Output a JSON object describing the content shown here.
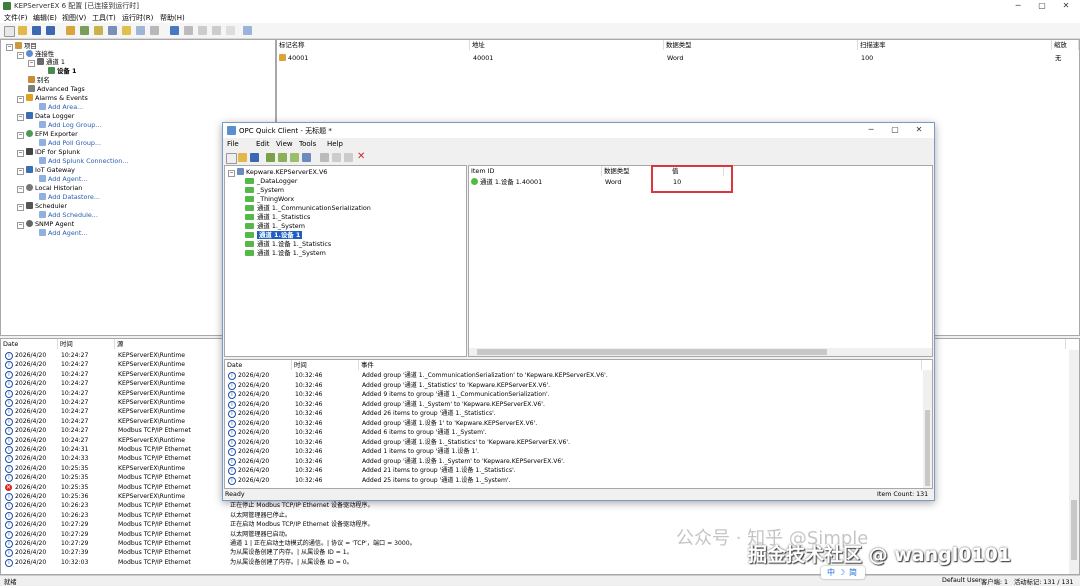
{
  "window": {
    "title": "KEPServerEX 6 配置 [已连接到运行时]",
    "min": "─",
    "max": "▢",
    "close": "✕"
  },
  "menu": [
    "文件(F)",
    "编辑(E)",
    "视图(V)",
    "工具(T)",
    "运行时(R)",
    "帮助(H)"
  ],
  "tree": {
    "project": "项目",
    "connectivity": "连接性",
    "channel": "通道 1",
    "device": "设备 1",
    "alias": "别名",
    "advanced_tags": "Advanced Tags",
    "alarms": "Alarms & Events",
    "add_area": "Add Area...",
    "data_logger": "Data Logger",
    "add_log_group": "Add Log Group...",
    "efm": "EFM Exporter",
    "add_poll_group": "Add Poll Group...",
    "idf": "IDF for Splunk",
    "add_splunk": "Add Splunk Connection...",
    "iot": "IoT Gateway",
    "add_agent": "Add Agent...",
    "historian": "Local Historian",
    "add_datastore": "Add Datastore...",
    "scheduler": "Scheduler",
    "add_schedule": "Add Schedule...",
    "snmp": "SNMP Agent",
    "add_agent2": "Add Agent..."
  },
  "tag_table": {
    "headers": [
      "标记名称",
      "地址",
      "数据类型",
      "扫描速率",
      "缩放"
    ],
    "row": {
      "name": "40001",
      "address": "40001",
      "type": "Word",
      "rate": "100",
      "scale": "无"
    }
  },
  "log": {
    "headers": [
      "Date",
      "时间",
      "源",
      "事件"
    ],
    "rows": [
      {
        "icon": "info",
        "date": "2026/4/20",
        "time": "10:24:27",
        "source": "KEPServerEX\\Runtime",
        "event": ""
      },
      {
        "icon": "info",
        "date": "2026/4/20",
        "time": "10:24:27",
        "source": "KEPServerEX\\Runtime",
        "event": ""
      },
      {
        "icon": "info",
        "date": "2026/4/20",
        "time": "10:24:27",
        "source": "KEPServerEX\\Runtime",
        "event": ""
      },
      {
        "icon": "info",
        "date": "2026/4/20",
        "time": "10:24:27",
        "source": "KEPServerEX\\Runtime",
        "event": ""
      },
      {
        "icon": "info",
        "date": "2026/4/20",
        "time": "10:24:27",
        "source": "KEPServerEX\\Runtime",
        "event": ""
      },
      {
        "icon": "info",
        "date": "2026/4/20",
        "time": "10:24:27",
        "source": "KEPServerEX\\Runtime",
        "event": ""
      },
      {
        "icon": "info",
        "date": "2026/4/20",
        "time": "10:24:27",
        "source": "KEPServerEX\\Runtime",
        "event": ""
      },
      {
        "icon": "info",
        "date": "2026/4/20",
        "time": "10:24:27",
        "source": "KEPServerEX\\Runtime",
        "event": ""
      },
      {
        "icon": "info",
        "date": "2026/4/20",
        "time": "10:24:27",
        "source": "Modbus TCP/IP Ethernet",
        "event": ""
      },
      {
        "icon": "info",
        "date": "2026/4/20",
        "time": "10:24:27",
        "source": "KEPServerEX\\Runtime",
        "event": ""
      },
      {
        "icon": "info",
        "date": "2026/4/20",
        "time": "10:24:31",
        "source": "Modbus TCP/IP Ethernet",
        "event": ""
      },
      {
        "icon": "info",
        "date": "2026/4/20",
        "time": "10:24:33",
        "source": "Modbus TCP/IP Ethernet",
        "event": ""
      },
      {
        "icon": "info",
        "date": "2026/4/20",
        "time": "10:25:35",
        "source": "KEPServerEX\\Runtime",
        "event": ""
      },
      {
        "icon": "info",
        "date": "2026/4/20",
        "time": "10:25:35",
        "source": "Modbus TCP/IP Ethernet",
        "event": ""
      },
      {
        "icon": "error",
        "date": "2026/4/20",
        "time": "10:25:35",
        "source": "Modbus TCP/IP Ethernet",
        "event": ""
      },
      {
        "icon": "info",
        "date": "2026/4/20",
        "time": "10:25:36",
        "source": "KEPServerEX\\Runtime",
        "event": ""
      },
      {
        "icon": "info",
        "date": "2026/4/20",
        "time": "10:26:23",
        "source": "Modbus TCP/IP Ethernet",
        "event": "正在停止 Modbus TCP/IP Ethernet 设备驱动程序。"
      },
      {
        "icon": "info",
        "date": "2026/4/20",
        "time": "10:26:23",
        "source": "Modbus TCP/IP Ethernet",
        "event": "以太网管理器已停止。"
      },
      {
        "icon": "info",
        "date": "2026/4/20",
        "time": "10:27:29",
        "source": "Modbus TCP/IP Ethernet",
        "event": "正在启动 Modbus TCP/IP Ethernet 设备驱动程序。"
      },
      {
        "icon": "info",
        "date": "2026/4/20",
        "time": "10:27:29",
        "source": "Modbus TCP/IP Ethernet",
        "event": "以太网管理器已启动。"
      },
      {
        "icon": "info",
        "date": "2026/4/20",
        "time": "10:27:29",
        "source": "Modbus TCP/IP Ethernet",
        "event": "通道 1 | 正在启动主动模式的通信。| 协议 = 'TCP'，端口 = 3000。"
      },
      {
        "icon": "info",
        "date": "2026/4/20",
        "time": "10:27:39",
        "source": "Modbus TCP/IP Ethernet",
        "event": "为从属设备创建了内存。| 从属设备 ID = 1。"
      },
      {
        "icon": "info",
        "date": "2026/4/20",
        "time": "10:32:03",
        "source": "Modbus TCP/IP Ethernet",
        "event": "为从属设备创建了内存。| 从属设备 ID = 0。"
      }
    ]
  },
  "statusbar": {
    "left": "就绪",
    "user": "Default User",
    "clients": "客户端: 1",
    "active_tags": "活动标记: 131 / 131"
  },
  "opc": {
    "title": "OPC Quick Client - 无标题 *",
    "menu": [
      "File",
      "Edit",
      "View",
      "Tools",
      "Help"
    ],
    "tree": [
      "Kepware.KEPServerEX.V6",
      "_DataLogger",
      "_System",
      "_ThingWorx",
      "通道 1._CommunicationSerialization",
      "通道 1._Statistics",
      "通道 1._System",
      "通道 1.设备 1",
      "通道 1.设备 1._Statistics",
      "通道 1.设备 1._System"
    ],
    "item_headers": [
      "Item ID",
      "数据类型",
      "值"
    ],
    "item": {
      "id": "通道 1.设备 1.40001",
      "type": "Word",
      "value": "10"
    },
    "log_headers": [
      "Date",
      "时间",
      "事件"
    ],
    "log": [
      {
        "date": "2026/4/20",
        "time": "10:32:46",
        "event": "Added group '通道 1._CommunicationSerialization' to 'Kepware.KEPServerEX.V6'."
      },
      {
        "date": "2026/4/20",
        "time": "10:32:46",
        "event": "Added group '通道 1._Statistics' to 'Kepware.KEPServerEX.V6'."
      },
      {
        "date": "2026/4/20",
        "time": "10:32:46",
        "event": "Added 9 items to group '通道 1._CommunicationSerialization'."
      },
      {
        "date": "2026/4/20",
        "time": "10:32:46",
        "event": "Added group '通道 1._System' to 'Kepware.KEPServerEX.V6'."
      },
      {
        "date": "2026/4/20",
        "time": "10:32:46",
        "event": "Added 26 items to group '通道 1._Statistics'."
      },
      {
        "date": "2026/4/20",
        "time": "10:32:46",
        "event": "Added group '通道 1.设备 1' to 'Kepware.KEPServerEX.V6'."
      },
      {
        "date": "2026/4/20",
        "time": "10:32:46",
        "event": "Added 6 items to group '通道 1._System'."
      },
      {
        "date": "2026/4/20",
        "time": "10:32:46",
        "event": "Added group '通道 1.设备 1._Statistics' to 'Kepware.KEPServerEX.V6'."
      },
      {
        "date": "2026/4/20",
        "time": "10:32:46",
        "event": "Added 1 items to group '通道 1.设备 1'."
      },
      {
        "date": "2026/4/20",
        "time": "10:32:46",
        "event": "Added group '通道 1.设备 1._System' to 'Kepware.KEPServerEX.V6'."
      },
      {
        "date": "2026/4/20",
        "time": "10:32:46",
        "event": "Added 21 items to group '通道 1.设备 1._Statistics'."
      },
      {
        "date": "2026/4/20",
        "time": "10:32:46",
        "event": "Added 25 items to group '通道 1.设备 1._System'."
      }
    ],
    "status_left": "Ready",
    "item_count": "Item Count: 131"
  },
  "watermark": {
    "line1": "公众号 · 知乎 @Simple",
    "line2": "掘金技术社区 @ wangl0101"
  },
  "ime": {
    "a": "中",
    "b": "简"
  },
  "colors": {
    "accent": "#2a5db0",
    "highlight_border": "#d9363e",
    "folder": "#54b948",
    "selected": "#1f5fbf"
  }
}
